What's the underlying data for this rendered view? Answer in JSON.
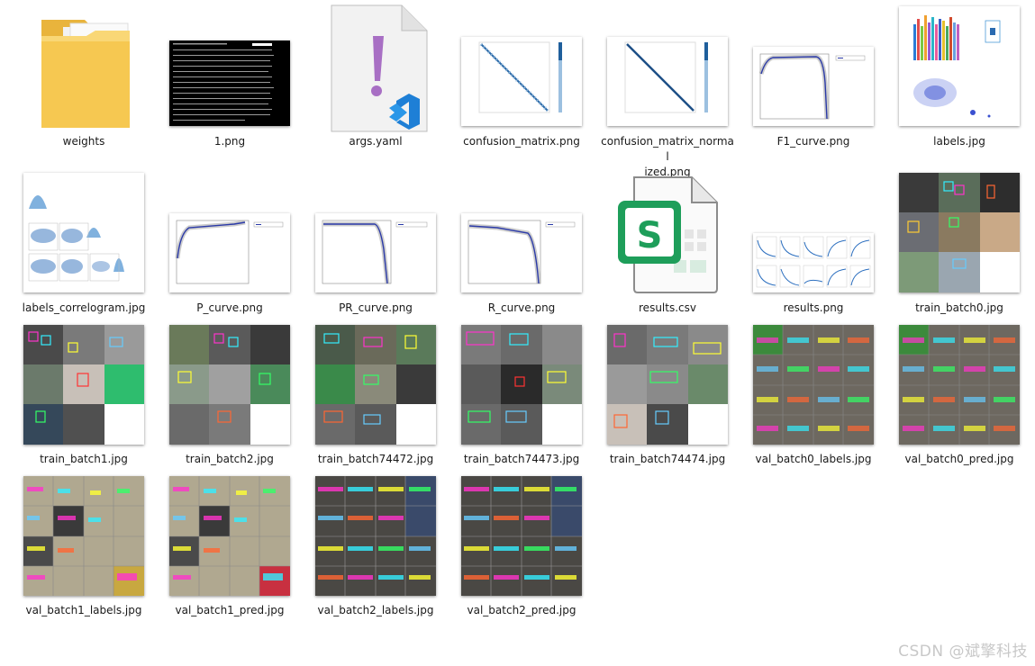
{
  "files": [
    {
      "name": "weights",
      "kind": "folder"
    },
    {
      "name": "1.png",
      "kind": "terminal"
    },
    {
      "name": "args.yaml",
      "kind": "yaml"
    },
    {
      "name": "confusion_matrix.png",
      "kind": "matrix"
    },
    {
      "name": "confusion_matrix_normal\nized.png",
      "kind": "matrix"
    },
    {
      "name": "F1_curve.png",
      "kind": "curve"
    },
    {
      "name": "labels.jpg",
      "kind": "labels"
    },
    {
      "name": "labels_correlogram.jpg",
      "kind": "correlogram"
    },
    {
      "name": "P_curve.png",
      "kind": "curve"
    },
    {
      "name": "PR_curve.png",
      "kind": "curve"
    },
    {
      "name": "R_curve.png",
      "kind": "curve"
    },
    {
      "name": "results.csv",
      "kind": "csv"
    },
    {
      "name": "results.png",
      "kind": "results"
    },
    {
      "name": "train_batch0.jpg",
      "kind": "mosaic"
    },
    {
      "name": "train_batch1.jpg",
      "kind": "mosaic"
    },
    {
      "name": "train_batch2.jpg",
      "kind": "mosaic"
    },
    {
      "name": "train_batch74472.jpg",
      "kind": "mosaic"
    },
    {
      "name": "train_batch74473.jpg",
      "kind": "mosaic"
    },
    {
      "name": "train_batch74474.jpg",
      "kind": "mosaic"
    },
    {
      "name": "val_batch0_labels.jpg",
      "kind": "mosaic"
    },
    {
      "name": "val_batch0_pred.jpg",
      "kind": "mosaic"
    },
    {
      "name": "val_batch1_labels.jpg",
      "kind": "mosaic"
    },
    {
      "name": "val_batch1_pred.jpg",
      "kind": "mosaic"
    },
    {
      "name": "val_batch2_labels.jpg",
      "kind": "mosaic"
    },
    {
      "name": "val_batch2_pred.jpg",
      "kind": "mosaic"
    }
  ],
  "watermark": "CSDN @斌擎科技",
  "colors": {
    "folder": "#f6c851",
    "csv": "#1e9e5a",
    "yaml_mark": "#a86fc4",
    "vscode": "#1e7fd6"
  }
}
